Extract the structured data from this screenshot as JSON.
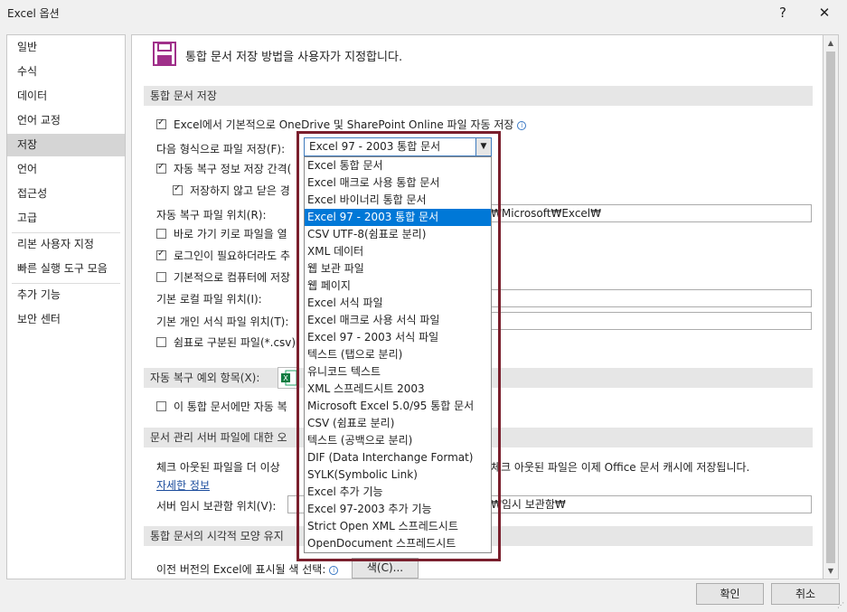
{
  "window": {
    "title": "Excel 옵션",
    "help": "?",
    "close": "✕"
  },
  "nav": {
    "items": [
      {
        "label": "일반"
      },
      {
        "label": "수식"
      },
      {
        "label": "데이터"
      },
      {
        "label": "언어 교정"
      },
      {
        "label": "저장",
        "selected": true
      },
      {
        "label": "언어"
      },
      {
        "label": "접근성"
      },
      {
        "label": "고급"
      },
      {
        "label": "리본 사용자 지정"
      },
      {
        "label": "빠른 실행 도구 모음"
      },
      {
        "label": "추가 기능"
      },
      {
        "label": "보안 센터"
      }
    ]
  },
  "main": {
    "heading": "통합 문서 저장 방법을 사용자가 지정합니다.",
    "sections": {
      "save": "통합 문서 저장",
      "autorecover_exceptions": "자동 복구 예외 항목(X):",
      "server_files": "문서 관리 서버 파일에 대한 오",
      "visual": "통합 문서의 시각적 모양 유지"
    },
    "onedrive_autosave": "Excel에서 기본적으로 OneDrive 및 SharePoint Online 파일 자동 저장",
    "save_format_label": "다음 형식으로 파일 저장(F):",
    "autorecover_interval": "자동 복구 정보 저장 간격(",
    "keep_unsaved": "저장하지 않고 닫은 경",
    "autorecover_location_label": "자동 복구 파일 위치(R):",
    "autorecover_location_value": "₩Microsoft₩Excel₩",
    "shortcut_open": "바로 가기 키로 파일을 열",
    "login_required": "로그인이 필요하더라도 추",
    "default_computer": "기본적으로 컴퓨터에 저장",
    "local_location_label": "기본 로컬 파일 위치(I):",
    "personal_templates_label": "기본 개인 서식 파일 위치(T):",
    "csv_label": "쉼표로 구분된 파일(*.csv)",
    "this_workbook_only": "이 통합 문서에만 자동 복",
    "server_note_left": "체크 아웃된 파일을 더 이상",
    "server_note_right": "체크 아웃된 파일은 이제 Office 문서 캐시에 저장됩니다.",
    "more_info": "자세한 정보",
    "server_drafts_label": "서버 임시 보관함 위치(V):",
    "server_drafts_value": "₩임시 보관함₩",
    "prev_colors_label": "이전 버전의 Excel에 표시될 색 선택:",
    "colors_button": "색(C)..."
  },
  "dropdown": {
    "value": "Excel 97 - 2003 통합 문서",
    "options": [
      "Excel 통합 문서",
      "Excel 매크로 사용 통합 문서",
      "Excel 바이너리 통합 문서",
      "Excel 97 - 2003 통합 문서",
      "CSV UTF-8(쉼표로 분리)",
      "XML 데이터",
      "웹 보관 파일",
      "웹 페이지",
      "Excel 서식 파일",
      "Excel 매크로 사용 서식 파일",
      "Excel 97 - 2003 서식 파일",
      "텍스트 (탭으로 분리)",
      "유니코드 텍스트",
      "XML 스프레드시트 2003",
      "Microsoft Excel 5.0/95 통합 문서",
      "CSV (쉼표로 분리)",
      "텍스트 (공백으로 분리)",
      "DIF (Data Interchange Format)",
      "SYLK(Symbolic Link)",
      "Excel 추가 기능",
      "Excel 97-2003 추가 기능",
      "Strict Open XML 스프레드시트",
      "OpenDocument 스프레드시트"
    ],
    "selected_index": 3
  },
  "footer": {
    "ok": "확인",
    "cancel": "취소"
  },
  "colors": {
    "selection": "#0078d7",
    "highlight_frame": "#7a1f2d",
    "nav_selected": "#d5d5d5"
  },
  "icons": [
    "save-disk-icon",
    "info-icon",
    "excel-file-icon",
    "chevron-down-icon",
    "close-icon",
    "help-icon"
  ]
}
